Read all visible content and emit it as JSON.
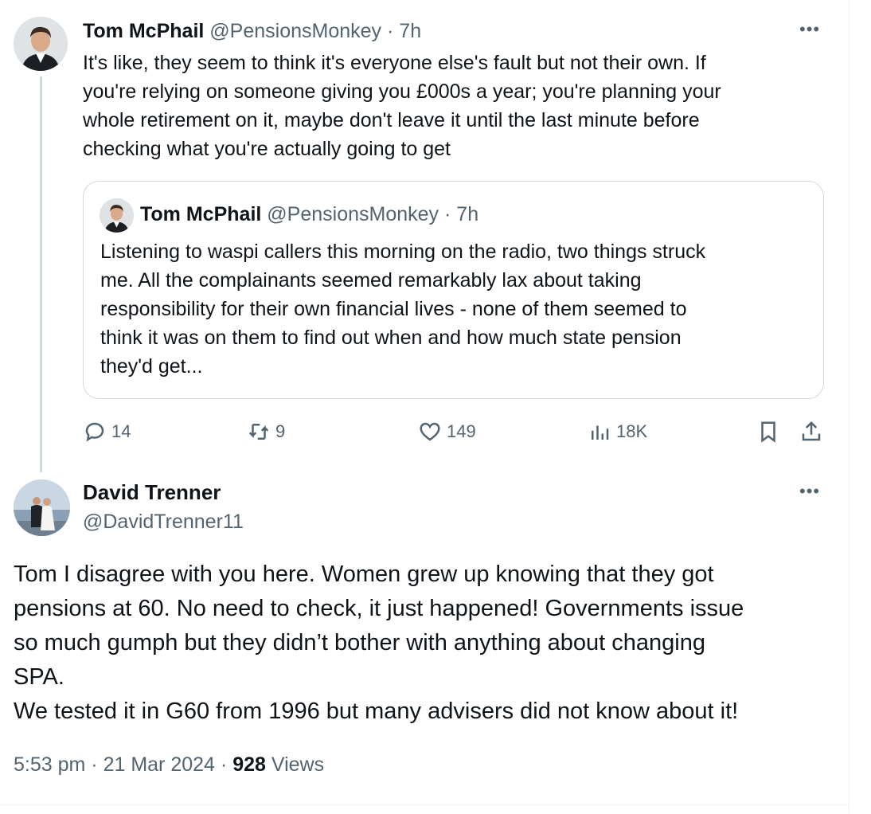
{
  "parent_tweet": {
    "author_name": "Tom McPhail",
    "author_handle": "@PensionsMonkey",
    "separator": "·",
    "time": "7h",
    "text": "It's like, they seem to think it's everyone else's fault but not their own. If\nyou're relying on someone giving you £000s a year; you're planning your\nwhole retirement on it, maybe don't leave it until the last minute  before\nchecking what you're actually going to get",
    "more_icon": "more-horizontal-icon",
    "quoted_tweet": {
      "author_name": "Tom McPhail",
      "author_handle": "@PensionsMonkey",
      "separator": "·",
      "time": "7h",
      "text": "Listening to waspi callers this morning on the radio, two things struck\nme. All the complainants seemed remarkably lax about taking\nresponsibility for their own financial lives - none of them seemed to\nthink it was on them to find out when and how much state pension\nthey'd get..."
    },
    "actions": {
      "replies": "14",
      "retweets": "9",
      "likes": "149",
      "views": "18K"
    }
  },
  "focused_tweet": {
    "author_name": "David Trenner",
    "author_handle": "@DavidTrenner11",
    "more_icon": "more-horizontal-icon",
    "text": "Tom I disagree with you here. Women grew up knowing that they got\npensions at 60. No need to check, it just happened! Governments issue\nso much gumph but they didn’t bother with anything about changing\nSPA.\nWe tested it in G60 from 1996 but many advisers did not know about it!",
    "time": "5:53 pm",
    "separator": "·",
    "date": "21 Mar 2024",
    "views_count": "928",
    "views_label": "Views"
  },
  "colors": {
    "text_primary": "#0f1419",
    "text_secondary": "#536471",
    "border": "#cfd9de",
    "thread_line": "#cfd9de"
  }
}
